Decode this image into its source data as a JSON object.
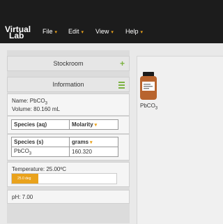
{
  "app": {
    "logo_line1": "Virtual",
    "logo_line2": "Lab"
  },
  "menu": [
    {
      "label": "File"
    },
    {
      "label": "Edit"
    },
    {
      "label": "View"
    },
    {
      "label": "Help"
    }
  ],
  "stockroom": {
    "title": "Stockroom"
  },
  "information": {
    "title": "Information",
    "name_prefix": "Name: PbCO",
    "name_sub": "3",
    "volume": "Volume: 80.160 mL",
    "aq_table": {
      "headers": [
        "Species (aq)",
        "Molarity"
      ]
    },
    "s_table": {
      "headers": [
        "Species (s)",
        "grams"
      ],
      "rows": [
        {
          "species": "PbCO",
          "species_sub": "3",
          "value": "160.320"
        }
      ]
    },
    "temperature": {
      "label": "Temperature: 25.00ºC",
      "bar_text": "25.0 deg",
      "level": 0.25
    },
    "ph": "pH: 7.00"
  },
  "workbench": {
    "bottle_label": "PbCO",
    "bottle_label_sub": "3"
  },
  "colors": {
    "accent": "#e9a21c",
    "green": "#7cb342",
    "navbar": "#1c1c1c"
  }
}
